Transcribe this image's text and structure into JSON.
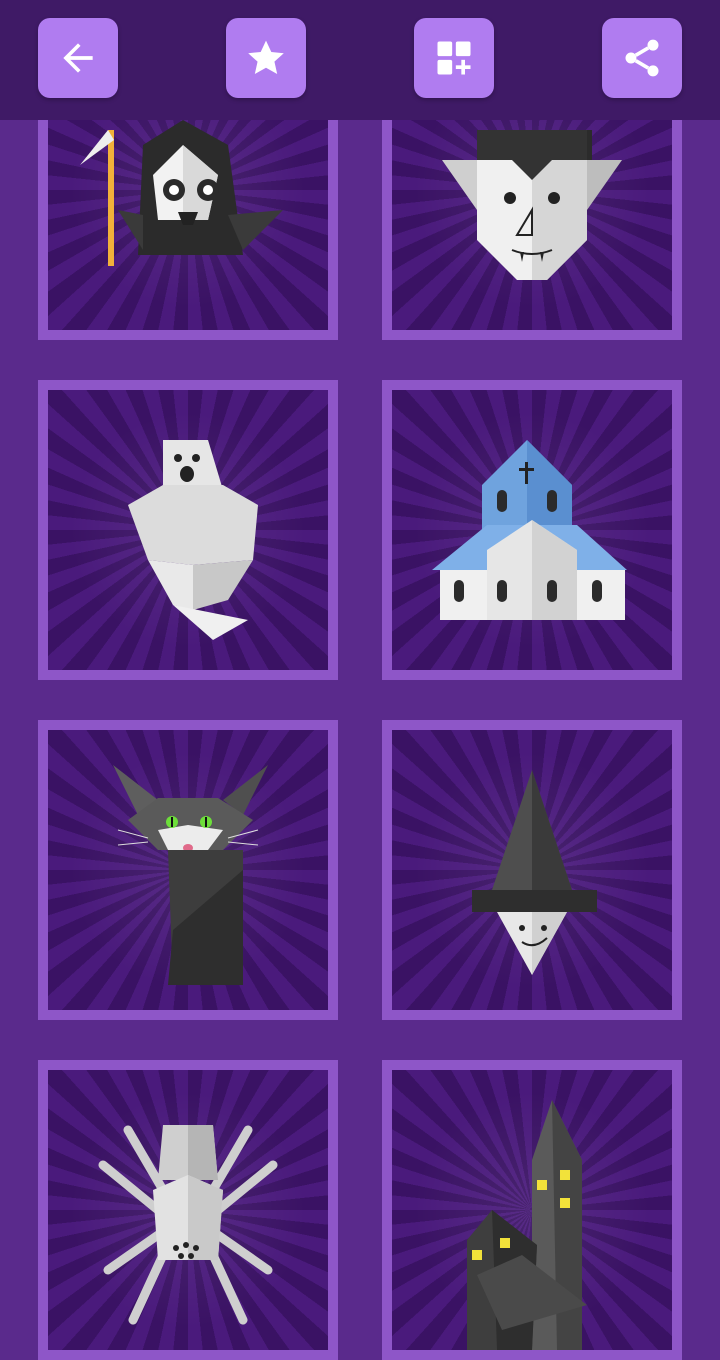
{
  "colors": {
    "topbar_bg": "#3f1a66",
    "button_bg": "#b07cf0",
    "page_bg": "#5a2a8c",
    "tile_border": "#8e56c8"
  },
  "toolbar": {
    "back_icon": "arrow-left-icon",
    "favorite_icon": "star-icon",
    "more_apps_icon": "grid-plus-icon",
    "share_icon": "share-icon"
  },
  "tiles": [
    {
      "subject": "grim-reaper"
    },
    {
      "subject": "vampire"
    },
    {
      "subject": "ghost"
    },
    {
      "subject": "church"
    },
    {
      "subject": "cat"
    },
    {
      "subject": "witch"
    },
    {
      "subject": "spider"
    },
    {
      "subject": "haunted-house"
    }
  ]
}
